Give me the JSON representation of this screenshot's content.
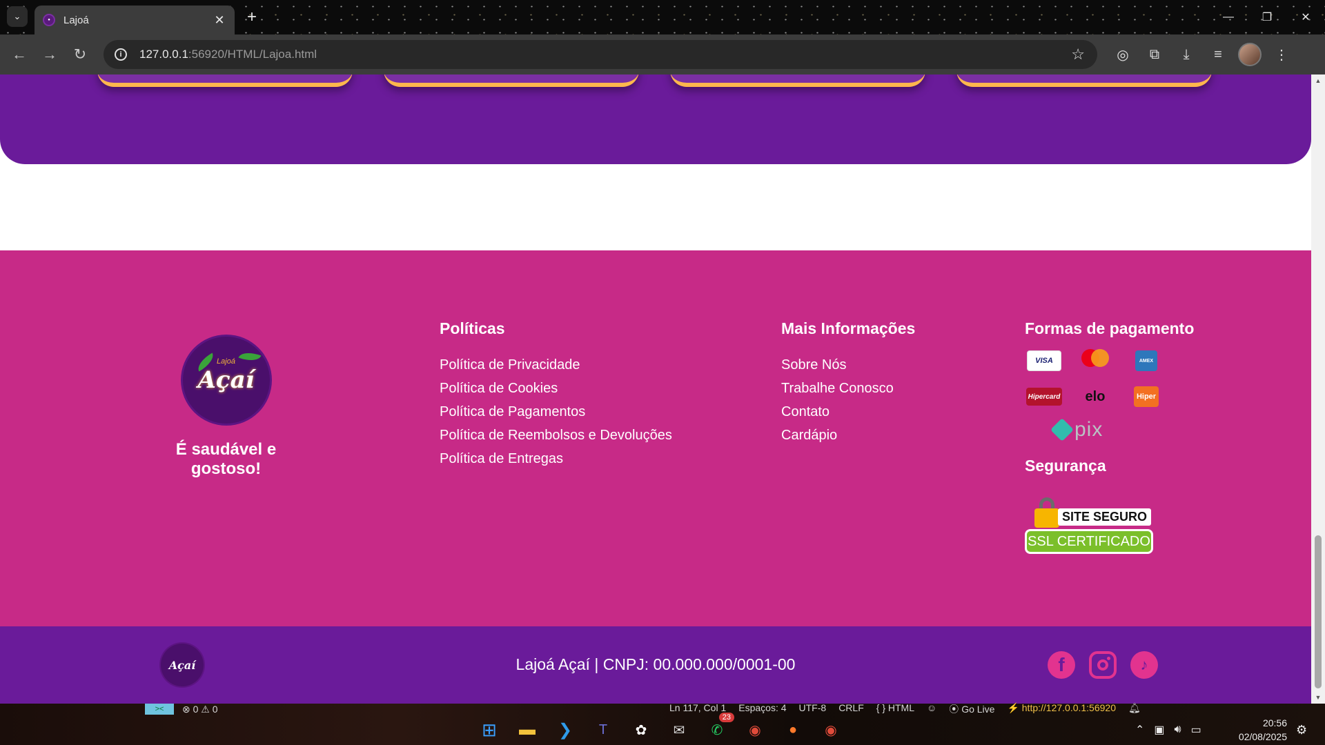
{
  "browser": {
    "tab_title": "Lajoá",
    "url_host": "127.0.0.1",
    "url_rest": ":56920/HTML/Lajoa.html",
    "window_controls": [
      "minimize-icon",
      "restore-icon",
      "close-icon"
    ]
  },
  "footer": {
    "slogan": "É saudável e gostoso!",
    "logo_text": "Açaí",
    "logo_small": "Lajoá",
    "policies": {
      "title": "Políticas",
      "links": [
        "Política de Privacidade",
        "Política de Cookies",
        "Política de Pagamentos",
        "Política de Reembolsos e Devoluções",
        "Política de Entregas"
      ]
    },
    "more_info": {
      "title": "Mais Informações",
      "links": [
        "Sobre Nós",
        "Trabalhe Conosco",
        "Contato",
        "Cardápio"
      ]
    },
    "payment": {
      "title": "Formas de pagamento",
      "methods": [
        "VISA",
        "Mastercard",
        "American Express",
        "Hipercard",
        "elo",
        "Hiper",
        "pix"
      ]
    },
    "security": {
      "title": "Segurança",
      "badge_top": "SITE SEGURO",
      "badge_bottom": "SSL CERTIFICADO"
    },
    "bottom_text": "Lajoá Açaí | CNPJ: 00.000.000/0001-00",
    "socials": [
      "facebook-icon",
      "instagram-icon",
      "tiktok-icon"
    ]
  },
  "vscode_status": {
    "errors": "0",
    "warnings": "0",
    "position": "Ln 117, Col 1",
    "spaces": "Espaços: 4",
    "encoding": "UTF-8",
    "eol": "CRLF",
    "language": "{ } HTML",
    "go_live": "Go Live",
    "live_url": "http://127.0.0.1:56920"
  },
  "taskbar": {
    "whatsapp_badge": "23",
    "time": "20:56",
    "date": "02/08/2025"
  },
  "colors": {
    "footer_pink": "#c72a87",
    "brand_purple": "#6a1b9a",
    "accent_orange": "#ffb74d"
  }
}
